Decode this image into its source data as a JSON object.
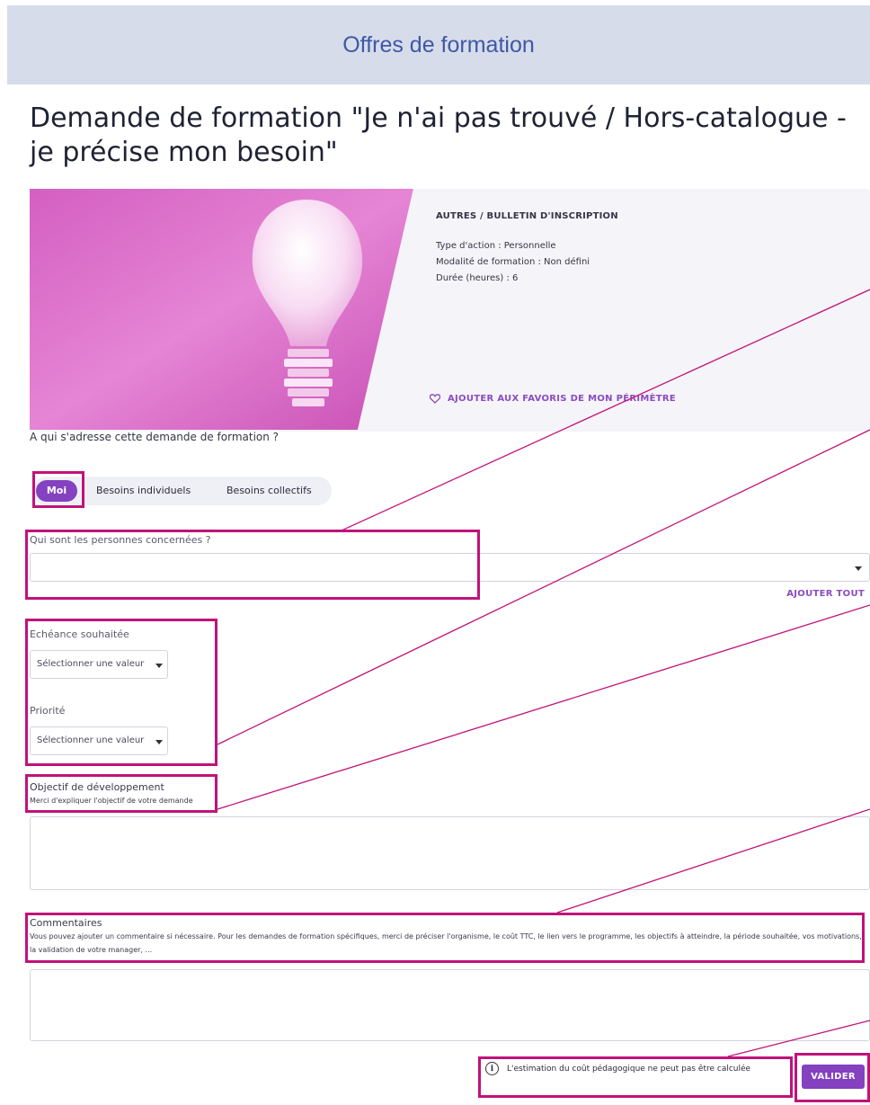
{
  "header": {
    "title": "Offres de formation"
  },
  "page": {
    "title": "Demande de formation \"Je n'ai pas trouvé / Hors-catalogue - je précise mon besoin\""
  },
  "card": {
    "category": "AUTRES / BULLETIN D'INSCRIPTION",
    "action_type": "Type d'action :  Personnelle",
    "modality": "Modalité de formation :  Non défini",
    "duration": "Durée (heures) :  6",
    "favorite_label": "AJOUTER AUX FAVORIS DE MON PÉRIMÈTRE",
    "favorite_icon": "heart-outline-icon"
  },
  "audience": {
    "question": "A qui s'adresse cette demande de formation ?",
    "options": [
      "Moi",
      "Besoins individuels",
      "Besoins collectifs"
    ],
    "selected": "Moi"
  },
  "persons": {
    "label": "Qui sont les personnes concernées ?",
    "value": "",
    "add_all": "AJOUTER TOUT"
  },
  "deadline": {
    "label": "Echéance souhaitée",
    "placeholder": "Sélectionner une valeur"
  },
  "priority": {
    "label": "Priorité",
    "placeholder": "Sélectionner une valeur"
  },
  "objective": {
    "label": "Objectif de développement",
    "help": "Merci d'expliquer l'objectif de votre demande",
    "value": ""
  },
  "comments": {
    "label": "Commentaires",
    "help": "Vous pouvez ajouter un commentaire si nécessaire. Pour les demandes de formation spécifiques, merci de préciser l'organisme, le coût TTC, le lien vers le programme, les objectifs à atteindre, la période souhaitée, vos motivations, la validation de votre manager, ...",
    "value": ""
  },
  "footer": {
    "cost_note": "L'estimation du coût pédagogique ne peut pas être calculée",
    "info_icon": "info-icon",
    "validate": "VALIDER"
  },
  "colors": {
    "accent": "#8441c0",
    "highlight": "#c1127a",
    "header_bg": "#d6dcea",
    "header_text": "#3f58a6"
  }
}
